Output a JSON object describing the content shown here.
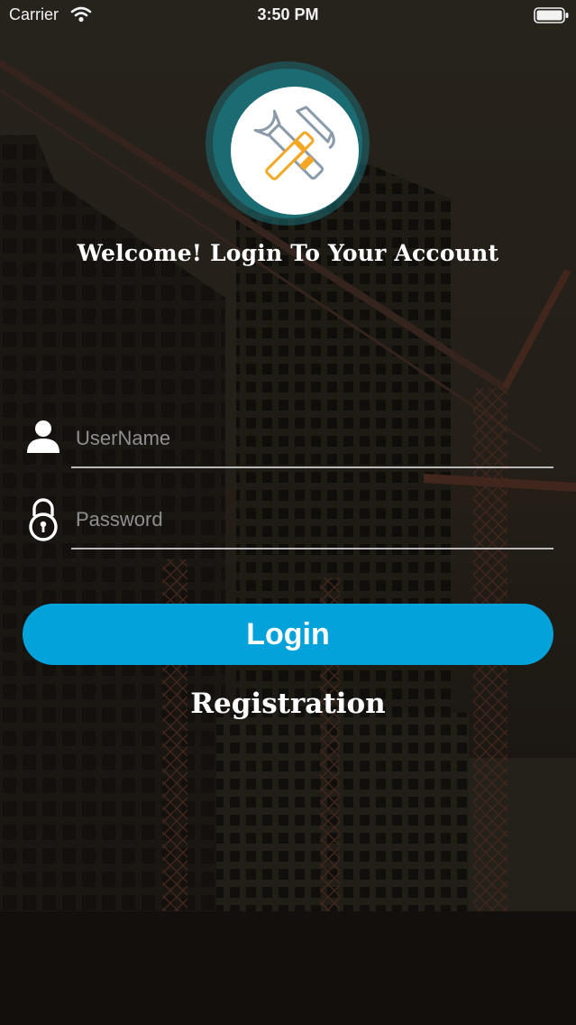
{
  "status_bar": {
    "carrier": "Carrier",
    "time": "3:50 PM",
    "wifi_icon": "wifi-icon",
    "battery_icon": "battery-icon"
  },
  "logo": {
    "icon": "wrench-hammer-icon"
  },
  "welcome_text": "Welcome! Login To Your Account",
  "form": {
    "username": {
      "icon": "user-icon",
      "placeholder": "UserName",
      "value": ""
    },
    "password": {
      "icon": "lock-icon",
      "placeholder": "Password",
      "value": ""
    }
  },
  "login_button": "Login",
  "registration_link": "Registration",
  "colors": {
    "accent": "#03a2db",
    "logo_ring": "#1b6b72",
    "tool_orange": "#f5a623",
    "tool_gray": "#8a9aa8"
  }
}
